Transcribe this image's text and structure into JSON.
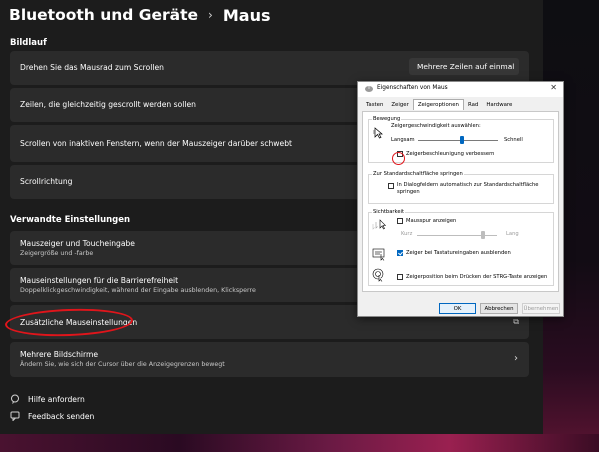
{
  "breadcrumb": {
    "parent": "Bluetooth und Geräte",
    "current": "Maus"
  },
  "scroll_section": {
    "title": "Bildlauf",
    "rows": [
      {
        "label": "Drehen Sie das Mausrad zum Scrollen",
        "dropdown": "Mehrere Zeilen auf einmal"
      },
      {
        "label": "Zeilen, die gleichzeitig gescrollt werden sollen"
      },
      {
        "label": "Scrollen von inaktiven Fenstern, wenn der Mauszeiger darüber schwebt"
      },
      {
        "label": "Scrollrichtung"
      }
    ]
  },
  "related_section": {
    "title": "Verwandte Einstellungen",
    "rows": [
      {
        "label": "Mauszeiger und Toucheingabe",
        "sub": "Zeigergröße und -farbe"
      },
      {
        "label": "Mauseinstellungen für die Barrierefreiheit",
        "sub": "Doppelklickgeschwindigkeit, während der Eingabe ausblenden, Klicksperre"
      },
      {
        "label": "Zusätzliche Mauseinstellungen"
      },
      {
        "label": "Mehrere Bildschirme",
        "sub": "Ändern Sie, wie sich der Cursor über die Anzeigegrenzen bewegt"
      }
    ]
  },
  "footer": {
    "help": "Hilfe anfordern",
    "feedback": "Feedback senden"
  },
  "dialog": {
    "title": "Eigenschaften von Maus",
    "tabs": [
      "Tasten",
      "Zeiger",
      "Zeigeroptionen",
      "Rad",
      "Hardware"
    ],
    "active_tab": "Zeigeroptionen",
    "motion": {
      "group_title": "Bewegung",
      "speed_label": "Zeigergeschwindigkeit auswählen:",
      "slow": "Langsam",
      "fast": "Schnell",
      "speed_level": 0.55,
      "enhance_precision": "Zeigerbeschleunigung verbessern",
      "enhance_precision_checked": false
    },
    "snap": {
      "group_title": "Zur Standardschaltfläche springen",
      "label_line1": "In Dialogfeldern automatisch zur Standardschaltfläche",
      "label_line2": "springen",
      "checked": false
    },
    "visibility": {
      "group_title": "Sichtbarkeit",
      "trails": "Mausspur anzeigen",
      "trails_checked": false,
      "short": "Kurz",
      "long": "Lang",
      "trail_level": 0.83,
      "hide_typing": "Zeiger bei Tastatureingaben ausblenden",
      "hide_typing_checked": true,
      "show_location": "Zeigerposition beim Drücken der STRG-Taste anzeigen",
      "show_location_checked": false
    },
    "buttons": {
      "ok": "OK",
      "cancel": "Abbrechen",
      "apply": "Übernehmen"
    }
  },
  "colors": {
    "settings_bg": "#1c1c1c",
    "card_bg": "#2b2b2b",
    "accent": "#0067c0",
    "annotation": "#e0151b"
  }
}
